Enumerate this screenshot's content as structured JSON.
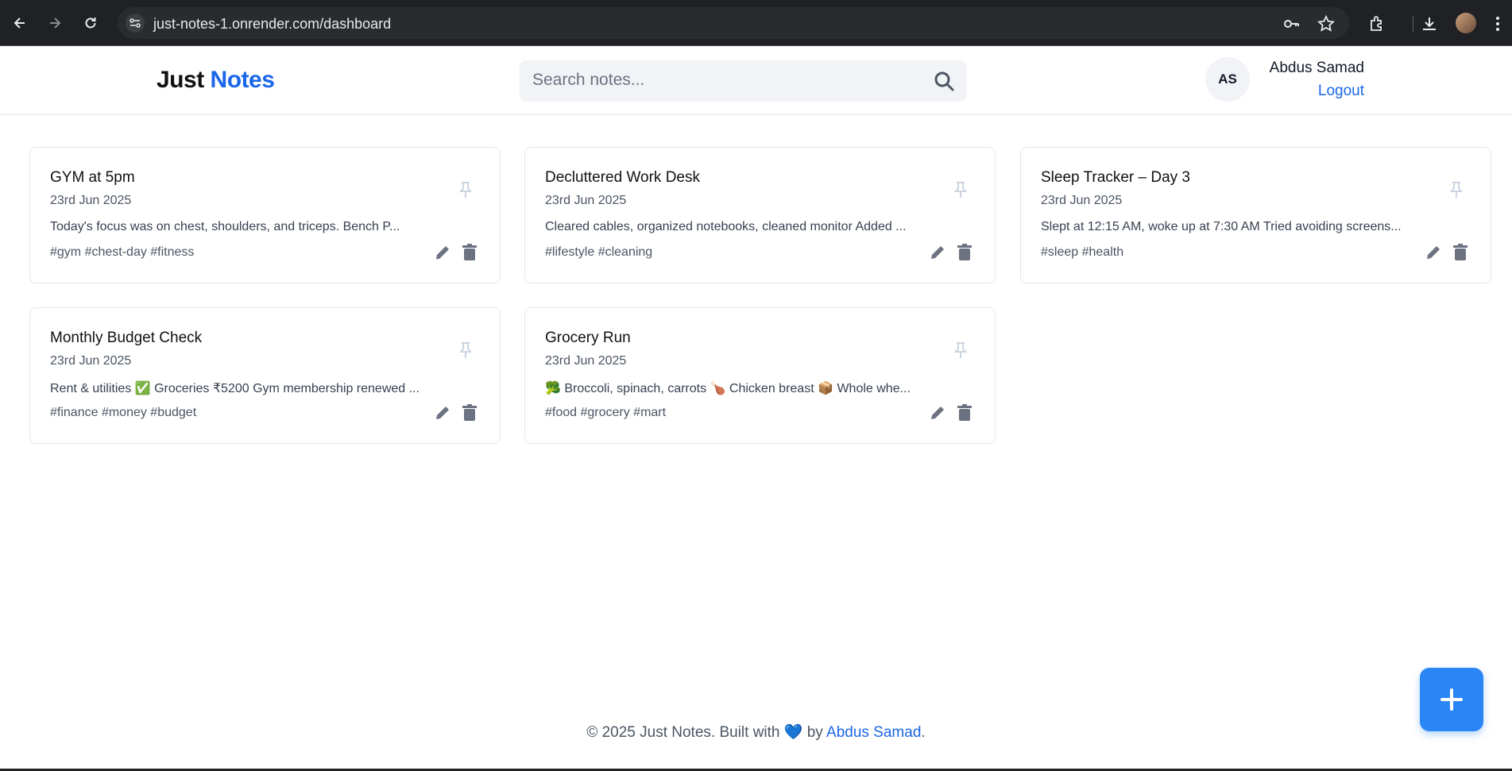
{
  "browser": {
    "url": "just-notes-1.onrender.com/dashboard"
  },
  "header": {
    "logo_part1": "Just",
    "logo_part2": "Notes",
    "search_placeholder": "Search notes...",
    "user_initials": "AS",
    "user_name": "Abdus Samad",
    "logout_label": "Logout"
  },
  "notes": [
    {
      "title": "GYM at 5pm",
      "date": "23rd Jun 2025",
      "body": "Today's focus was on chest, shoulders, and triceps. Bench P...",
      "tags": "#gym #chest-day #fitness"
    },
    {
      "title": "Decluttered Work Desk",
      "date": "23rd Jun 2025",
      "body": "Cleared cables, organized notebooks, cleaned monitor Added ...",
      "tags": "#lifestyle #cleaning"
    },
    {
      "title": "Sleep Tracker – Day 3",
      "date": "23rd Jun 2025",
      "body": "Slept at 12:15 AM, woke up at 7:30 AM Tried avoiding screens...",
      "tags": "#sleep #health"
    },
    {
      "title": "Monthly Budget Check",
      "date": "23rd Jun 2025",
      "body": "Rent & utilities ✅ Groceries ₹5200 Gym membership renewed ...",
      "tags": "#finance #money #budget"
    },
    {
      "title": "Grocery Run",
      "date": "23rd Jun 2025",
      "body": "🥦 Broccoli, spinach, carrots 🍗 Chicken breast 📦 Whole whe...",
      "tags": "#food #grocery #mart"
    }
  ],
  "footer": {
    "text_prefix": "© 2025 Just Notes. Built with",
    "heart": "💙",
    "by": "by",
    "author": "Abdus Samad",
    "suffix": "."
  },
  "colors": {
    "brand_blue": "#1a66e8",
    "fab_blue": "#2b86f5",
    "chrome_bg": "#202124"
  }
}
